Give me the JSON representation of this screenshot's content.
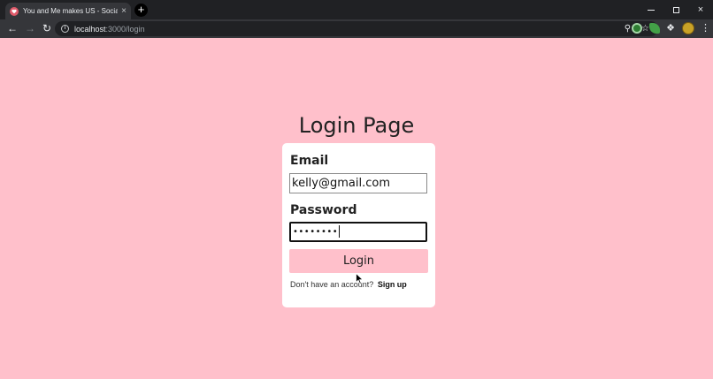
{
  "browser": {
    "tab_title": "You and Me makes US - Social N",
    "tab_close": "×",
    "new_tab": "+",
    "url_host": "localhost",
    "url_path": ":3000/login",
    "window_controls": {
      "minimize": "",
      "maximize": "",
      "close": "×"
    }
  },
  "page": {
    "title": "Login Page",
    "email_label": "Email",
    "email_value": "kelly@gmail.com",
    "password_label": "Password",
    "password_value": "••••••••",
    "login_button": "Login",
    "signup_prompt": "Don't have an account?",
    "signup_link": "Sign up"
  },
  "colors": {
    "page_background": "#ffc0cb",
    "card_background": "#ffffff",
    "button_background": "#ffc0cb"
  },
  "icons": [
    "heart-icon",
    "close-icon",
    "plus-icon",
    "back-arrow-icon",
    "forward-arrow-icon",
    "reload-icon",
    "info-icon",
    "key-icon",
    "star-icon",
    "extension-icon",
    "puzzle-icon",
    "avatar",
    "menu-dots-icon",
    "cursor-icon"
  ]
}
